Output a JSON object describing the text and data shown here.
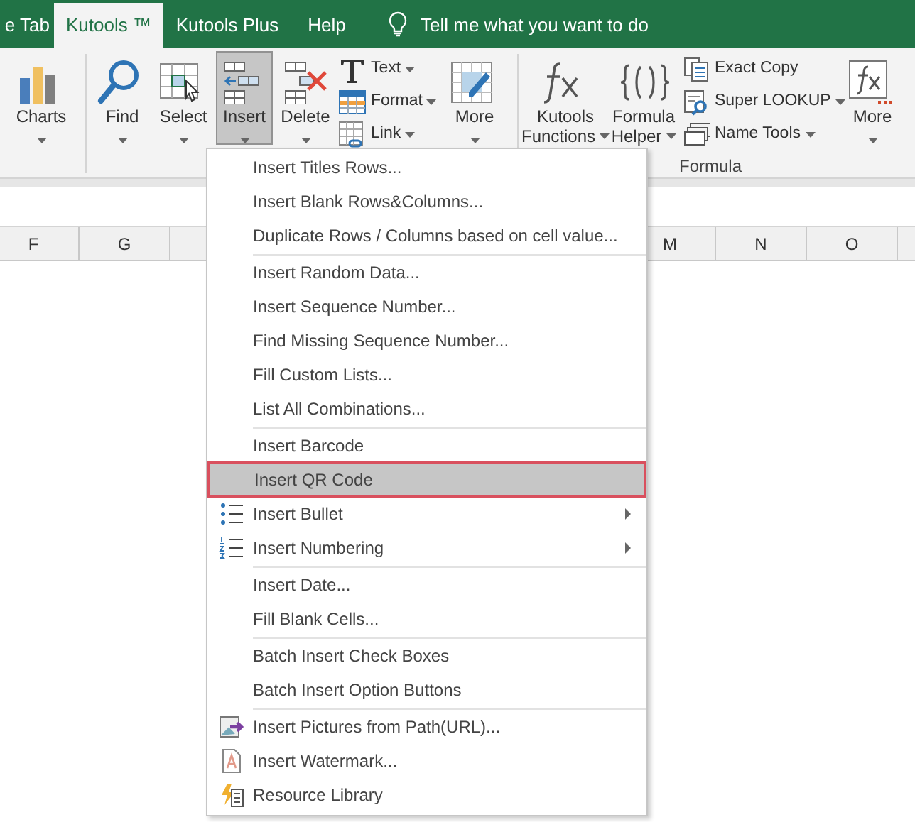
{
  "tabs": [
    {
      "label": "e Tab",
      "selected": false
    },
    {
      "label": "Kutools ™",
      "selected": true
    },
    {
      "label": "Kutools Plus",
      "selected": false
    },
    {
      "label": "Help",
      "selected": false
    }
  ],
  "tell_me": "Tell me what you want to do",
  "ribbon": {
    "items": [
      {
        "kind": "large",
        "label": [
          "Charts"
        ],
        "dropdown": true,
        "selected": false
      },
      {
        "kind": "separator"
      },
      {
        "kind": "large",
        "label": [
          "Find"
        ],
        "dropdown": true,
        "selected": false
      },
      {
        "kind": "large",
        "label": [
          "Select"
        ],
        "dropdown": true,
        "selected": false
      },
      {
        "kind": "large",
        "label": [
          "Insert"
        ],
        "dropdown": true,
        "selected": true
      },
      {
        "kind": "large",
        "label": [
          "Delete"
        ],
        "dropdown": true,
        "selected": false
      },
      {
        "kind": "stack",
        "buttons": [
          {
            "label": "Text",
            "dropdown": true
          },
          {
            "label": "Format",
            "dropdown": true
          },
          {
            "label": "Link",
            "dropdown": true
          }
        ]
      },
      {
        "kind": "large",
        "label": [
          "More"
        ],
        "dropdown": true,
        "selected": false
      },
      {
        "kind": "separator"
      },
      {
        "kind": "large",
        "label": [
          "Kutools",
          "Functions"
        ],
        "dropdown": true,
        "selected": false
      },
      {
        "kind": "large",
        "label": [
          "Formula",
          "Helper"
        ],
        "dropdown": true,
        "selected": false
      },
      {
        "kind": "stack",
        "buttons": [
          {
            "label": "Exact Copy",
            "dropdown": false
          },
          {
            "label": "Super LOOKUP",
            "dropdown": true
          },
          {
            "label": "Name Tools",
            "dropdown": true
          }
        ]
      },
      {
        "kind": "large",
        "label": [
          "More"
        ],
        "dropdown": true,
        "selected": false
      }
    ],
    "group_label": "Formula"
  },
  "column_headers": {
    "left": [
      "F",
      "G"
    ],
    "right": [
      "M",
      "N",
      "O"
    ]
  },
  "menu": {
    "items": [
      {
        "kind": "plain",
        "label": "Insert Titles Rows...",
        "submenu": false,
        "selected": false
      },
      {
        "kind": "plain",
        "label": "Insert Blank Rows&Columns...",
        "submenu": false,
        "selected": false
      },
      {
        "kind": "plain",
        "label": "Duplicate Rows / Columns based on cell value...",
        "submenu": false,
        "selected": false
      },
      {
        "kind": "separator"
      },
      {
        "kind": "plain",
        "label": "Insert Random Data...",
        "submenu": false,
        "selected": false
      },
      {
        "kind": "plain",
        "label": "Insert Sequence Number...",
        "submenu": false,
        "selected": false
      },
      {
        "kind": "plain",
        "label": "Find Missing Sequence Number...",
        "submenu": false,
        "selected": false
      },
      {
        "kind": "plain",
        "label": "Fill Custom Lists...",
        "submenu": false,
        "selected": false
      },
      {
        "kind": "plain",
        "label": "List All Combinations...",
        "submenu": false,
        "selected": false
      },
      {
        "kind": "separator"
      },
      {
        "kind": "plain",
        "label": "Insert Barcode",
        "submenu": false,
        "selected": false
      },
      {
        "kind": "plain",
        "label": "Insert QR Code",
        "submenu": false,
        "selected": true
      },
      {
        "kind": "icon",
        "label": "Insert Bullet",
        "submenu": true,
        "selected": false
      },
      {
        "kind": "icon",
        "label": "Insert Numbering",
        "submenu": true,
        "selected": false
      },
      {
        "kind": "separator"
      },
      {
        "kind": "plain",
        "label": "Insert Date...",
        "submenu": false,
        "selected": false
      },
      {
        "kind": "plain",
        "label": "Fill Blank Cells...",
        "submenu": false,
        "selected": false
      },
      {
        "kind": "separator"
      },
      {
        "kind": "plain",
        "label": "Batch Insert Check Boxes",
        "submenu": false,
        "selected": false
      },
      {
        "kind": "plain",
        "label": "Batch Insert Option Buttons",
        "submenu": false,
        "selected": false
      },
      {
        "kind": "separator"
      },
      {
        "kind": "icon",
        "label": "Insert Pictures from Path(URL)...",
        "submenu": false,
        "selected": false
      },
      {
        "kind": "icon",
        "label": "Insert Watermark...",
        "submenu": false,
        "selected": false
      },
      {
        "kind": "icon",
        "label": "Resource Library",
        "submenu": false,
        "selected": false
      }
    ]
  }
}
